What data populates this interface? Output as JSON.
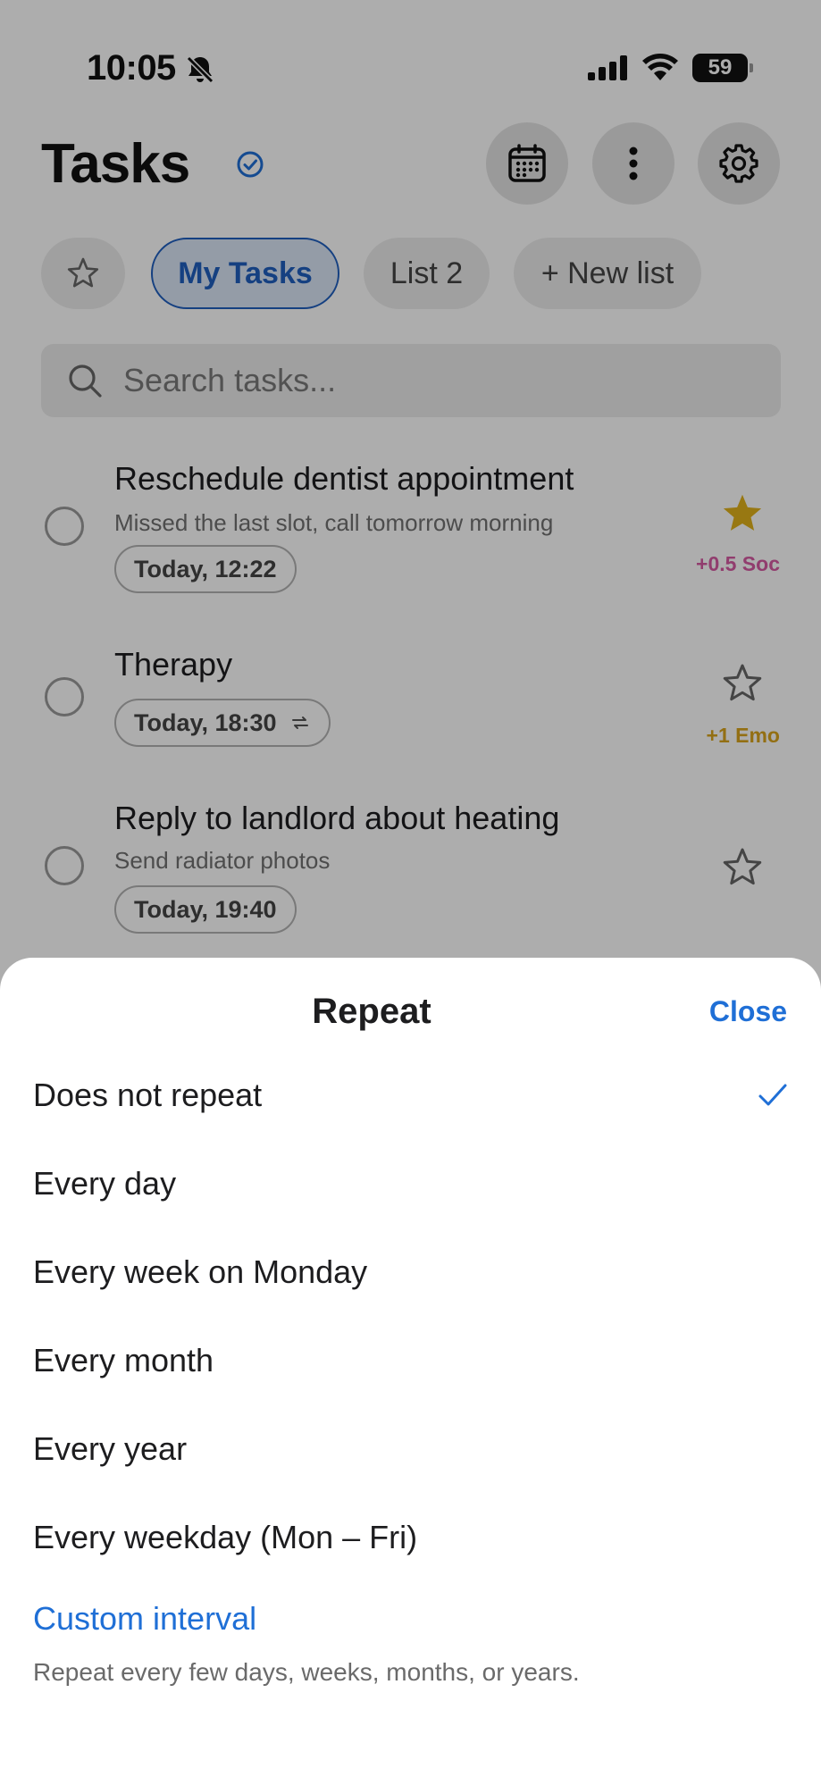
{
  "status_bar": {
    "time": "10:05",
    "battery": "59"
  },
  "header": {
    "title": "Tasks"
  },
  "chips": {
    "my_tasks": "My Tasks",
    "list2": "List 2",
    "new_list": "+ New list"
  },
  "search": {
    "placeholder": "Search tasks..."
  },
  "tasks": [
    {
      "title": "Reschedule dentist appointment",
      "subtitle": "Missed the last slot, call tomorrow morning",
      "due": "Today, 12:22",
      "starred": true,
      "points": "+0.5 Soc",
      "points_color": "#d65aa3"
    },
    {
      "title": "Therapy",
      "due": "Today, 18:30",
      "repeat": true,
      "starred": false,
      "points": "+1 Emo",
      "points_color": "#d9a41c"
    },
    {
      "title": "Reply to landlord about heating",
      "subtitle": "Send radiator photos",
      "due": "Today, 19:40",
      "starred": false
    }
  ],
  "sheet": {
    "title": "Repeat",
    "close": "Close",
    "options": [
      {
        "label": "Does not repeat",
        "selected": true
      },
      {
        "label": "Every day"
      },
      {
        "label": "Every week on Monday"
      },
      {
        "label": "Every month"
      },
      {
        "label": "Every year"
      },
      {
        "label": "Every weekday (Mon – Fri)"
      }
    ],
    "custom": {
      "label": "Custom interval",
      "description": "Repeat every few days, weeks, months, or years."
    }
  },
  "colors": {
    "accent": "#1f6fd6",
    "star_filled": "#e0b21b",
    "overlay": "rgba(0,0,0,0.32)"
  }
}
